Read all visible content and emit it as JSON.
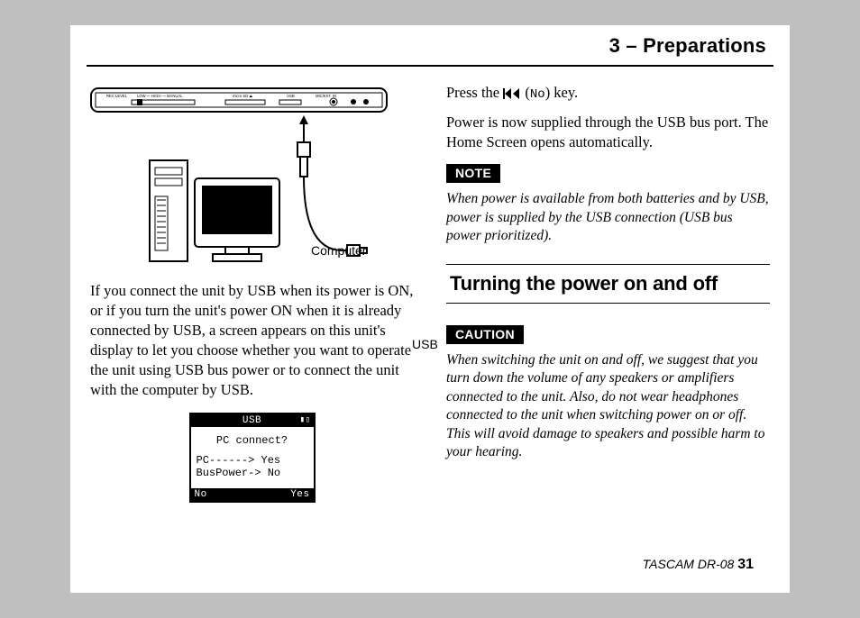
{
  "header": {
    "chapter": "3 – Preparations"
  },
  "left": {
    "diagram": {
      "device_labels": [
        "REC LEVEL",
        "LOW — HIGH — MANUAL",
        "micro SD",
        "USB",
        "MIC/EXT. IN"
      ],
      "computer_label": "Computer",
      "usb_label": "USB"
    },
    "para1": "If you connect the unit by USB when its power is ON, or if you turn the unit's power ON when it is already connected by USB, a screen appears on this unit's display to let you choose whether you want to operate the unit using USB bus power or to connect the unit with the computer by USB.",
    "lcd": {
      "title": "USB",
      "question": "PC connect?",
      "line1": "PC------> Yes",
      "line2": "BusPower-> No",
      "footer_left": "No",
      "footer_right": "Yes"
    }
  },
  "right": {
    "press_pre": "Press the ",
    "press_post": " (",
    "press_post2": ") key.",
    "key_symbol": "No",
    "para2": "Power is now supplied through the USB bus port. The Home Screen opens automatically.",
    "note_label": "NOTE",
    "note_text": "When power is available from both batteries and by USB, power is supplied by the USB connection (USB bus power prioritized).",
    "section_heading": "Turning the power on and off",
    "caution_label": "CAUTION",
    "caution_text": "When switching the unit on and off, we suggest that you turn down the volume of any speakers or amplifiers connected to the unit. Also, do not wear headphones connected to the unit when switching power on or off. This will avoid damage to speakers and possible harm to your hearing."
  },
  "footer": {
    "product": "TASCAM  DR-08",
    "page": "31"
  }
}
